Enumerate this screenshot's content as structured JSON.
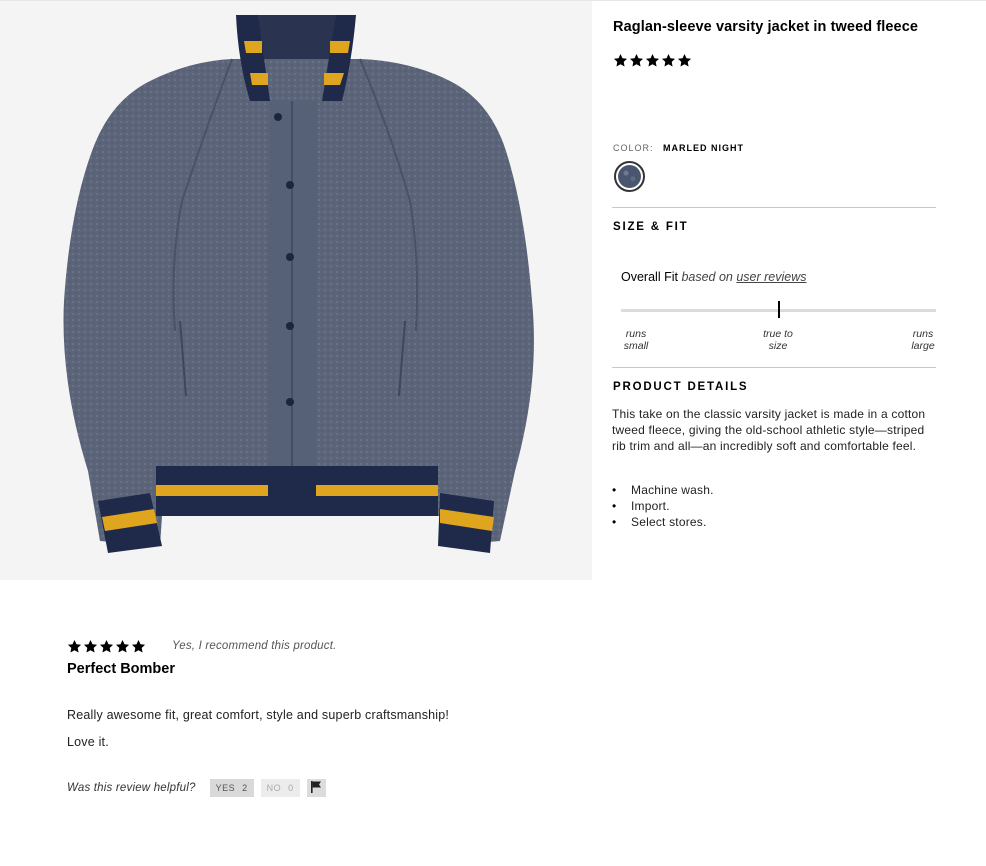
{
  "product": {
    "title": "Raglan-sleeve varsity jacket in tweed fleece",
    "rating": 5,
    "image_alt": "Raglan-sleeve varsity jacket",
    "color": {
      "label": "COLOR:",
      "value": "MARLED NIGHT",
      "swatch_color": "#4a5670"
    }
  },
  "size_fit": {
    "heading": "SIZE & FIT",
    "overall_fit": "Overall Fit",
    "based_on": "based on",
    "user_reviews_link": "user reviews",
    "fit_value": 0.5,
    "labels": {
      "small_1": "runs",
      "small_2": "small",
      "true_1": "true to",
      "true_2": "size",
      "large_1": "runs",
      "large_2": "large"
    }
  },
  "details": {
    "heading": "PRODUCT DETAILS",
    "description": "This take on the classic varsity jacket is made in a cotton tweed fleece, giving the old-school athletic style—striped rib trim and all—an incredibly soft and comfortable feel.",
    "bullets": [
      "Machine wash.",
      "Import.",
      "Select stores."
    ]
  },
  "review": {
    "rating": 5,
    "recommend": "Yes, I recommend this product.",
    "title": "Perfect Bomber",
    "body_1": "Really awesome fit, great comfort, style and superb craftsmanship!",
    "body_2": "Love it.",
    "helpful_question": "Was this review helpful?",
    "yes_label": "YES",
    "yes_count": "2",
    "no_label": "NO",
    "no_count": "0"
  },
  "colors": {
    "jacket_body": "#5b6478",
    "navy_rib": "#1f2a4a",
    "gold_stripe": "#e0a51e",
    "image_bg": "#f4f4f4"
  },
  "icons": {
    "star": "star-icon",
    "flag": "flag-icon"
  }
}
